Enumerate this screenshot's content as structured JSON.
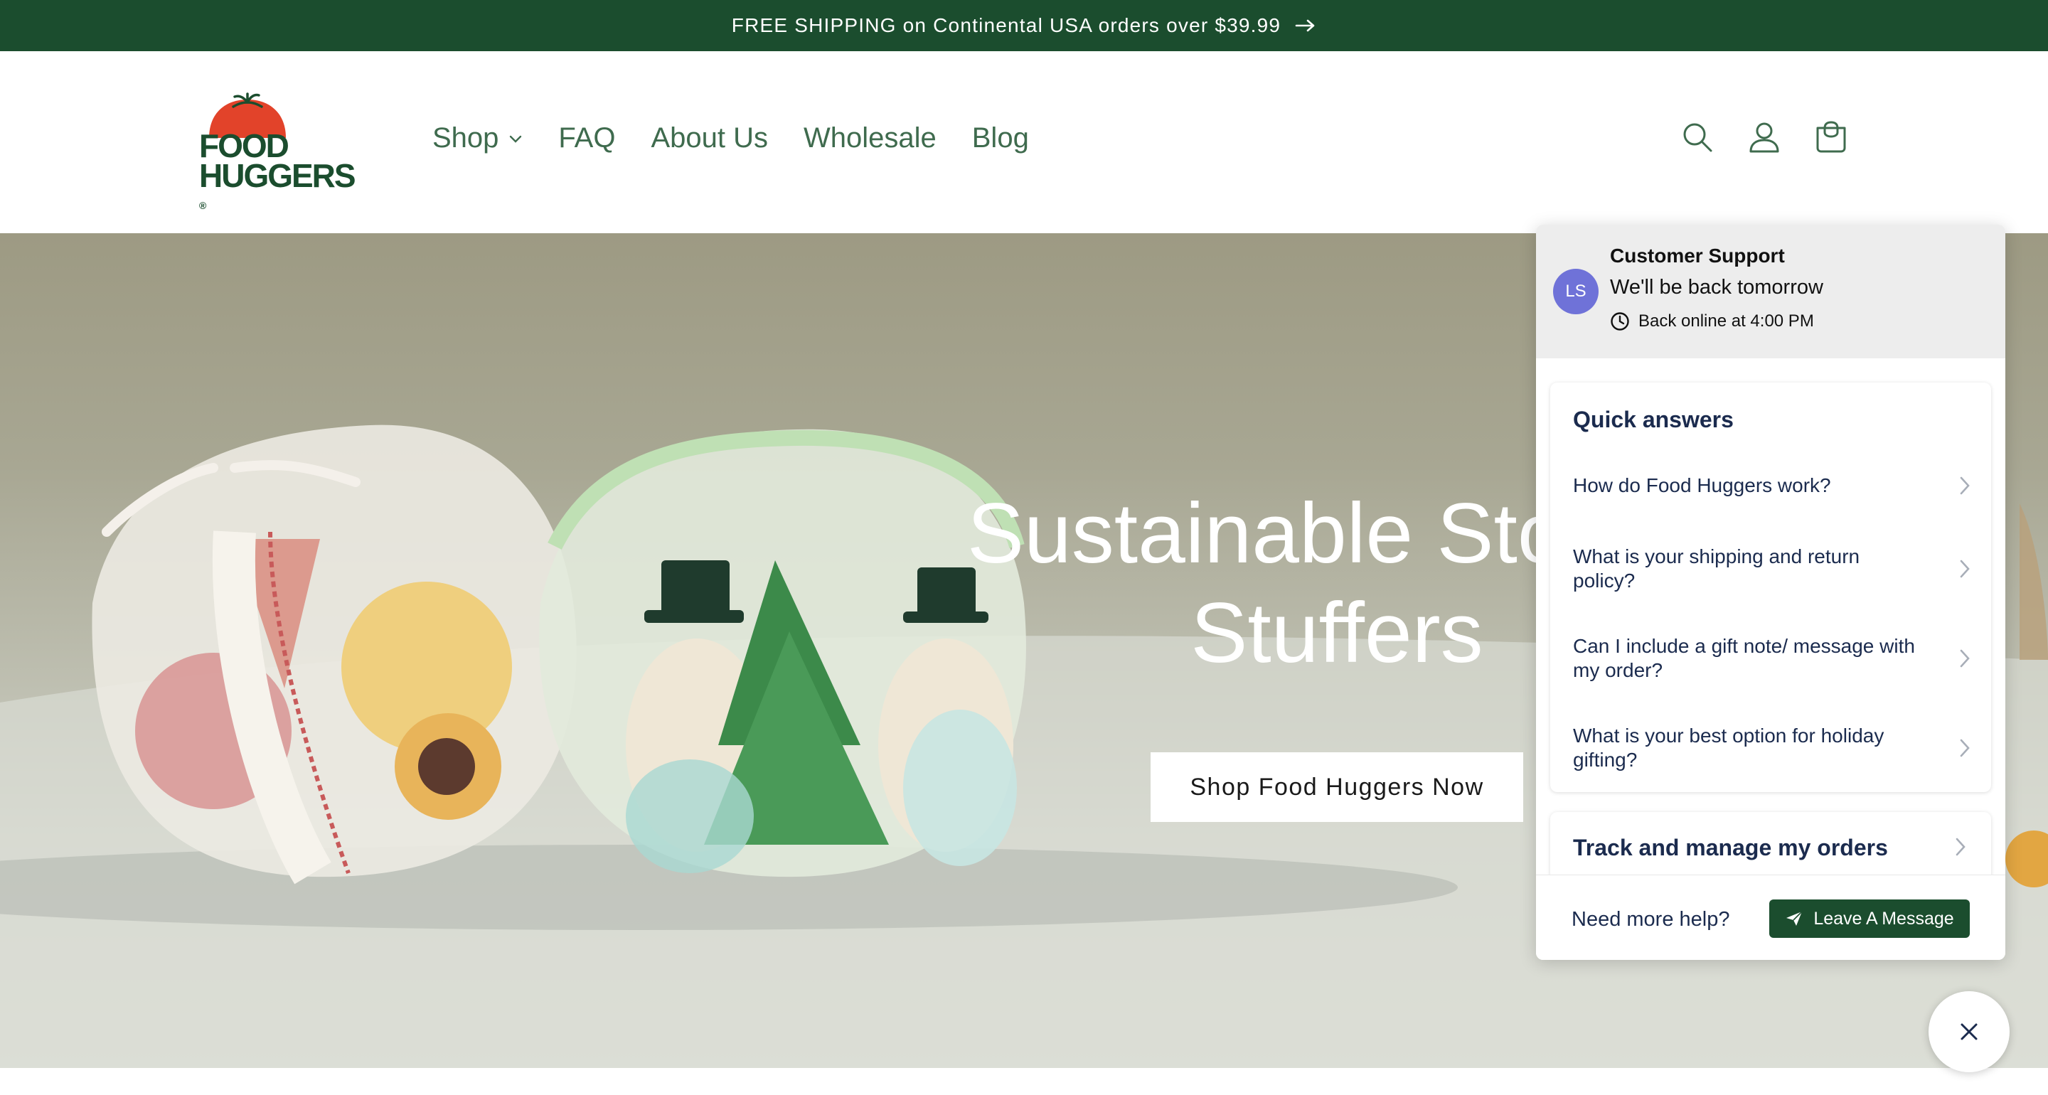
{
  "announcement": {
    "text": "FREE SHIPPING on Continental USA orders over $39.99",
    "icon": "arrow-right-icon"
  },
  "header": {
    "logo": {
      "line1": "FOOD",
      "line2": "HUGGERS",
      "registered": "®"
    },
    "nav": [
      {
        "label": "Shop",
        "has_dropdown": true
      },
      {
        "label": "FAQ"
      },
      {
        "label": "About Us"
      },
      {
        "label": "Wholesale"
      },
      {
        "label": "Blog"
      }
    ],
    "icons": [
      "search-icon",
      "account-icon",
      "cart-icon"
    ]
  },
  "hero": {
    "title_line1": "Sustainable Stocking",
    "title_line2": "Stuffers",
    "cta": "Shop Food Huggers Now"
  },
  "chat": {
    "avatar_initials": "LS",
    "agent_name": "Customer Support",
    "status": "We'll be back tomorrow",
    "online_note": "Back online at 4:00 PM",
    "quick_answers_title": "Quick answers",
    "quick_answers": [
      "How do Food Huggers work?",
      "What is your shipping and return policy?",
      "Can I include a gift note/ message with my order?",
      "What is your best option for holiday gifting?"
    ],
    "track_orders": "Track and manage my orders",
    "need_help": "Need more help?",
    "leave_message": "Leave A Message"
  },
  "colors": {
    "brand_green": "#1b4d2e",
    "nav_green": "#3f6b4e",
    "avatar": "#6f72d8",
    "tomato_red": "#e2432a"
  }
}
